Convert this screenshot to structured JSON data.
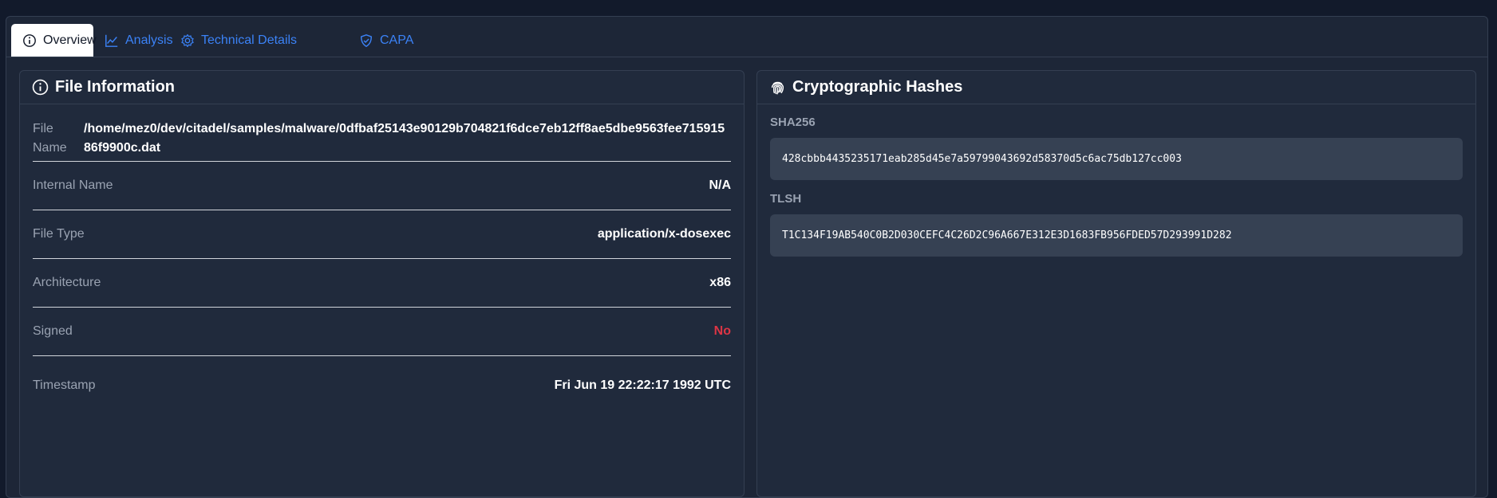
{
  "tabs": [
    {
      "label": "Overview",
      "icon": "info-circle-icon",
      "active": true
    },
    {
      "label": "Analysis",
      "icon": "chart-line-icon",
      "active": false
    },
    {
      "label": "Technical Details",
      "icon": "gear-icon",
      "active": false
    },
    {
      "label": "CAPA",
      "icon": "shield-check-icon",
      "active": false
    }
  ],
  "file_info": {
    "title": "File Information",
    "icon": "info-circle-icon",
    "file_name_label": "File Name",
    "file_name": "/home/mez0/dev/citadel/samples/malware/0dfbaf25143e90129b704821f6dce7eb12ff8ae5dbe9563fee71591586f9900c.dat",
    "rows": [
      {
        "label": "Internal Name",
        "value": "N/A"
      },
      {
        "label": "File Type",
        "value": "application/x-dosexec"
      },
      {
        "label": "Architecture",
        "value": "x86"
      },
      {
        "label": "Signed",
        "value": "No"
      },
      {
        "label": "Timestamp",
        "value": "Fri Jun 19 22:22:17 1992 UTC"
      }
    ]
  },
  "hashes": {
    "title": "Cryptographic Hashes",
    "icon": "fingerprint-icon",
    "items": [
      {
        "label": "SHA256",
        "value": "428cbbb4435235171eab285d45e7a59799043692d58370d5c6ac75db127cc003"
      },
      {
        "label": "TLSH",
        "value": "T1C134F19AB540C0B2D030CEFC4C26D2C96A667E312E3D1683FB956FDED57D293991D282"
      }
    ]
  },
  "colors": {
    "accent": "#3b82f6",
    "negative": "#dc3545"
  }
}
